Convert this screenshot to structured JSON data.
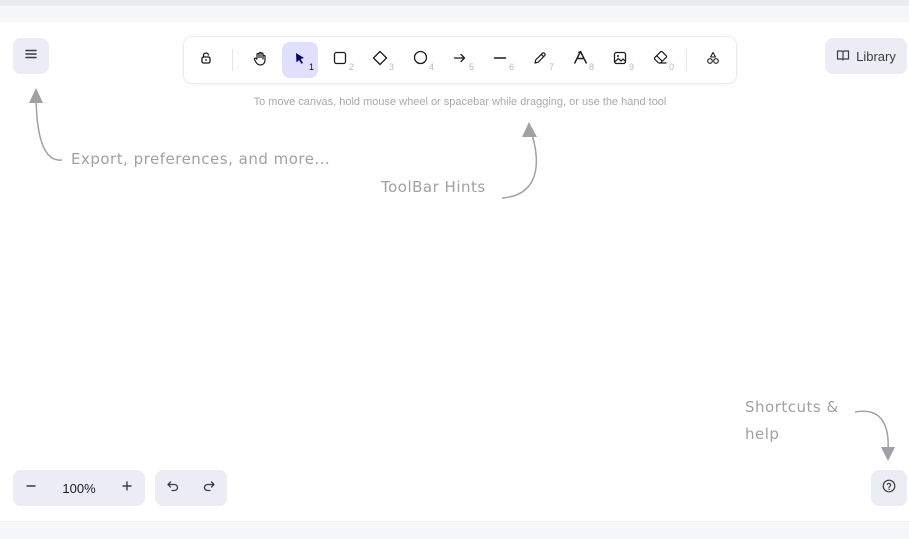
{
  "toolbar": {
    "tools": [
      {
        "name": "lock",
        "key": ""
      },
      {
        "name": "hand",
        "key": ""
      },
      {
        "name": "selection",
        "key": "1"
      },
      {
        "name": "rectangle",
        "key": "2"
      },
      {
        "name": "diamond",
        "key": "3"
      },
      {
        "name": "ellipse",
        "key": "4"
      },
      {
        "name": "arrow",
        "key": "5"
      },
      {
        "name": "line",
        "key": "6"
      },
      {
        "name": "draw",
        "key": "7"
      },
      {
        "name": "text",
        "key": "8"
      },
      {
        "name": "image",
        "key": "9"
      },
      {
        "name": "eraser",
        "key": "0"
      },
      {
        "name": "more-tools",
        "key": ""
      }
    ],
    "active_tool": "selection"
  },
  "library": {
    "label": "Library"
  },
  "canvas_hint": "To move canvas, hold mouse wheel or spacebar while dragging, or use the hand tool",
  "welcome": {
    "menu_hint": "Export, preferences, and more...",
    "toolbar_hint": "ToolBar Hints",
    "help_hint": "Shortcuts & help"
  },
  "footer": {
    "zoom_level": "100%"
  },
  "colors": {
    "accent": "#e0dfff",
    "accent_text": "#030064",
    "island_bg": "#ececf4"
  }
}
